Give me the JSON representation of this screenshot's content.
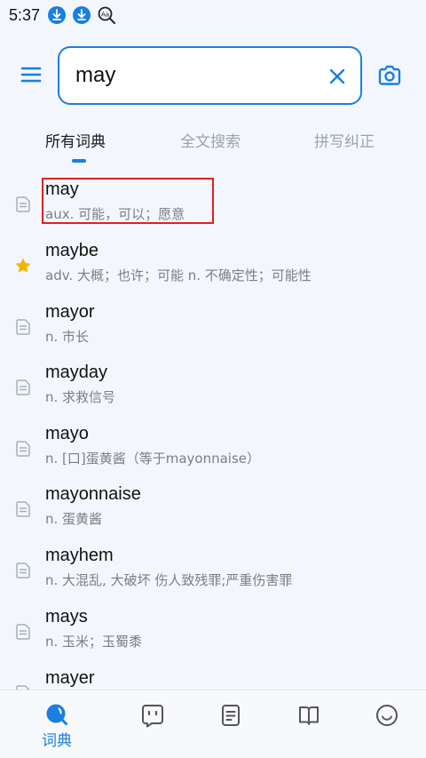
{
  "status": {
    "time": "5:37"
  },
  "search": {
    "value": "may"
  },
  "tabs": [
    {
      "label": "所有词典",
      "active": true
    },
    {
      "label": "全文搜索",
      "active": false
    },
    {
      "label": "拼写纠正",
      "active": false
    }
  ],
  "results": [
    {
      "word": "may",
      "def": "aux. 可能，可以；愿意",
      "starred": false,
      "highlighted": true
    },
    {
      "word": "maybe",
      "def": "adv. 大概；也许；可能 n. 不确定性；可能性",
      "starred": true
    },
    {
      "word": "mayor",
      "def": "n. 市长",
      "starred": false
    },
    {
      "word": "mayday",
      "def": "n. 求救信号",
      "starred": false
    },
    {
      "word": "mayo",
      "def": "n. [口]蛋黄酱（等于mayonnaise）",
      "starred": false
    },
    {
      "word": "mayonnaise",
      "def": "n. 蛋黄酱",
      "starred": false
    },
    {
      "word": "mayhem",
      "def": "n. 大混乱, 大破坏 伤人致残罪;严重伤害罪",
      "starred": false
    },
    {
      "word": "mays",
      "def": "n. 玉米；玉蜀黍",
      "starred": false
    },
    {
      "word": "mayer",
      "def": "",
      "starred": false
    }
  ],
  "bottom_nav": {
    "dictionary_label": "词典"
  },
  "colors": {
    "accent": "#1a7fe0",
    "star": "#f5b400",
    "highlight": "#e02020"
  }
}
